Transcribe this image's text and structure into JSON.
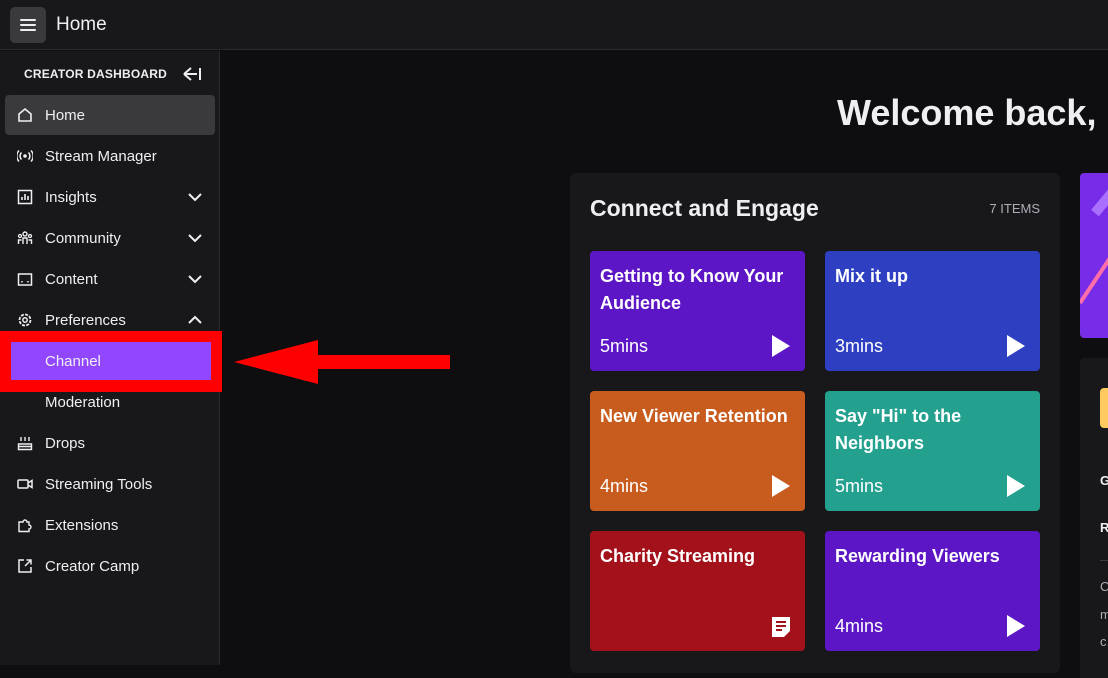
{
  "topbar": {
    "title": "Home"
  },
  "sidebar": {
    "header": "CREATOR DASHBOARD",
    "items": [
      {
        "label": "Home"
      },
      {
        "label": "Stream Manager"
      },
      {
        "label": "Insights"
      },
      {
        "label": "Community"
      },
      {
        "label": "Content"
      },
      {
        "label": "Preferences"
      },
      {
        "label": "Channel"
      },
      {
        "label": "Moderation"
      },
      {
        "label": "Drops"
      },
      {
        "label": "Streaming Tools"
      },
      {
        "label": "Extensions"
      },
      {
        "label": "Creator Camp"
      }
    ]
  },
  "main": {
    "welcome": "Welcome back, ",
    "panel": {
      "title": "Connect and Engage",
      "count": "7 ITEMS",
      "cards": [
        {
          "title": "Getting to Know Your Audience",
          "duration": "5mins",
          "color": "#5c16c5"
        },
        {
          "title": "Mix it up",
          "duration": "3mins",
          "color": "#2e3fc2"
        },
        {
          "title": "New Viewer Retention",
          "duration": "4mins",
          "color": "#c85b1e"
        },
        {
          "title": "Say \"Hi\" to the Neighbors",
          "duration": "5mins",
          "color": "#23a08e"
        },
        {
          "title": "Charity Streaming",
          "duration": "",
          "color": "#a3121b"
        },
        {
          "title": "Rewarding Viewers",
          "duration": "4mins",
          "color": "#5c16c5"
        }
      ]
    },
    "side": {
      "letter1": "G",
      "letter2": "R",
      "small1": "C",
      "small2": "m",
      "small3": "c"
    }
  },
  "colors": {
    "accent": "#9147ff",
    "highlight": "#ff0000"
  }
}
